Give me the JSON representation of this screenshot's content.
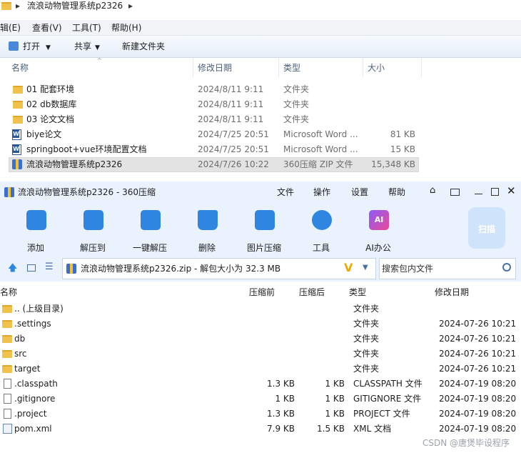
{
  "explorer": {
    "breadcrumb": "流浪动物管理系统p2326",
    "menu": [
      "辑(E)",
      "查看(V)",
      "工具(T)",
      "帮助(H)"
    ],
    "toolbar": {
      "open": "打开",
      "share": "共享",
      "new_folder": "新建文件夹"
    },
    "columns": {
      "name": "名称",
      "modified": "修改日期",
      "type": "类型",
      "size": "大小"
    },
    "rows": [
      {
        "name": "01 配套环境",
        "modified": "2024/8/11 9:11",
        "type": "文件夹",
        "size": "",
        "icon": "folder-icon"
      },
      {
        "name": "02 db数据库",
        "modified": "2024/8/11 9:11",
        "type": "文件夹",
        "size": "",
        "icon": "folder-icon"
      },
      {
        "name": "03 论文文档",
        "modified": "2024/8/11 9:11",
        "type": "文件夹",
        "size": "",
        "icon": "folder-icon"
      },
      {
        "name": "biye论文",
        "modified": "2024/7/25 20:51",
        "type": "Microsoft Word ...",
        "size": "81 KB",
        "icon": "word-icon"
      },
      {
        "name": "springboot+vue环境配置文档",
        "modified": "2024/7/25 20:51",
        "type": "Microsoft Word ...",
        "size": "15 KB",
        "icon": "word-icon"
      },
      {
        "name": "流浪动物管理系统p2326",
        "modified": "2024/7/26 10:22",
        "type": "360压缩 ZIP 文件",
        "size": "15,348 KB",
        "icon": "zip-icon"
      }
    ]
  },
  "zip": {
    "title": "流浪动物管理系统p2326 - 360压缩",
    "menu": [
      "文件",
      "操作",
      "设置",
      "帮助"
    ],
    "tools": [
      "添加",
      "解压到",
      "一键解压",
      "删除",
      "图片压缩",
      "工具",
      "AI办公"
    ],
    "scan": "扫描",
    "address": "流浪动物管理系统p2326.zip - 解包大小为 32.3 MB",
    "search_placeholder": "搜索包内文件",
    "columns": {
      "name": "名称",
      "before": "压缩前",
      "after": "压缩后",
      "type": "类型",
      "modified": "修改日期"
    },
    "rows": [
      {
        "name": ".. (上级目录)",
        "before": "",
        "after": "",
        "type": "文件夹",
        "modified": "",
        "icon": "folder-icon"
      },
      {
        "name": ".settings",
        "before": "",
        "after": "",
        "type": "文件夹",
        "modified": "2024-07-26 10:21",
        "icon": "folder-icon"
      },
      {
        "name": "db",
        "before": "",
        "after": "",
        "type": "文件夹",
        "modified": "2024-07-26 10:21",
        "icon": "folder-icon"
      },
      {
        "name": "src",
        "before": "",
        "after": "",
        "type": "文件夹",
        "modified": "2024-07-26 10:21",
        "icon": "folder-icon"
      },
      {
        "name": "target",
        "before": "",
        "after": "",
        "type": "文件夹",
        "modified": "2024-07-26 10:21",
        "icon": "folder-icon"
      },
      {
        "name": ".classpath",
        "before": "1.3 KB",
        "after": "1 KB",
        "type": "CLASSPATH 文件",
        "modified": "2024-07-19 08:20",
        "icon": "file-icon"
      },
      {
        "name": ".gitignore",
        "before": "1 KB",
        "after": "1 KB",
        "type": "GITIGNORE 文件",
        "modified": "2024-07-19 08:20",
        "icon": "file-icon"
      },
      {
        "name": ".project",
        "before": "1.3 KB",
        "after": "1 KB",
        "type": "PROJECT 文件",
        "modified": "2024-07-19 08:20",
        "icon": "file-icon"
      },
      {
        "name": "pom.xml",
        "before": "7.9 KB",
        "after": "1.5 KB",
        "type": "XML 文档",
        "modified": "2024-07-19 08:20",
        "icon": "xml-file-icon"
      }
    ]
  },
  "watermark": "CSDN @唐煲毕设程序"
}
